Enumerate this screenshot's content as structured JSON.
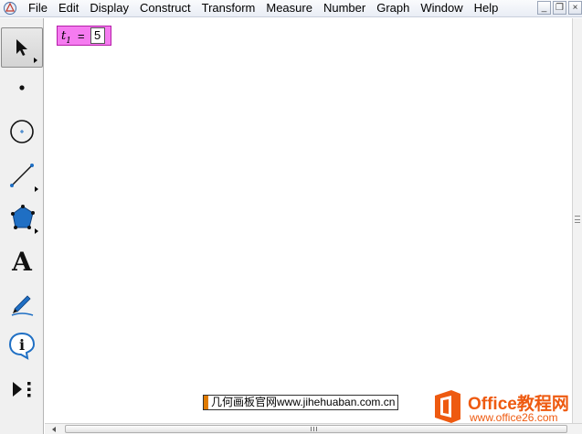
{
  "menu": {
    "items": [
      "File",
      "Edit",
      "Display",
      "Construct",
      "Transform",
      "Measure",
      "Number",
      "Graph",
      "Window",
      "Help"
    ]
  },
  "window_controls": {
    "minimize": "_",
    "restore": "❐",
    "close": "×"
  },
  "toolbox": {
    "tools": [
      {
        "name": "selection-arrow-tool",
        "icon": "arrow-icon"
      },
      {
        "name": "point-tool",
        "icon": "point-icon"
      },
      {
        "name": "compass-tool",
        "icon": "circle-icon"
      },
      {
        "name": "straightedge-tool",
        "icon": "segment-icon"
      },
      {
        "name": "polygon-tool",
        "icon": "polygon-icon"
      },
      {
        "name": "text-tool",
        "icon": "text-icon",
        "glyph": "A"
      },
      {
        "name": "marker-tool",
        "icon": "pen-icon"
      },
      {
        "name": "information-tool",
        "icon": "info-icon",
        "glyph": "i"
      },
      {
        "name": "custom-tool",
        "icon": "custom-tools-icon"
      }
    ]
  },
  "parameter": {
    "var": "t",
    "subscript": "1",
    "equals": "=",
    "value": "5"
  },
  "watermarks": {
    "site": "几何画板官网www.jihehuaban.com.cn",
    "office_brand": "Office教程网",
    "office_url": "www.office26.com"
  },
  "colors": {
    "parameter_fill": "#f57bf0",
    "polygon_tool": "#1f6fc4",
    "office_orange": "#ee5a10"
  }
}
